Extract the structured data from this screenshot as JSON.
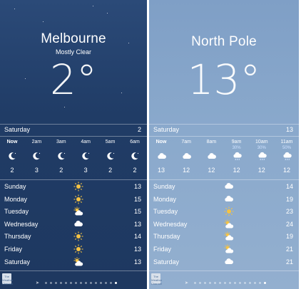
{
  "left": {
    "city": "Melbourne",
    "condition": "Mostly Clear",
    "temperature": "2°",
    "today": {
      "day": "Saturday",
      "value": "2"
    },
    "hours": [
      {
        "label": "Now",
        "icon": "moon-icon",
        "temp": "2"
      },
      {
        "label": "2am",
        "icon": "moon-icon",
        "temp": "3"
      },
      {
        "label": "3am",
        "icon": "moon-icon",
        "temp": "2"
      },
      {
        "label": "4am",
        "icon": "moon-icon",
        "temp": "3"
      },
      {
        "label": "5am",
        "icon": "moon-icon",
        "temp": "2"
      },
      {
        "label": "6am",
        "icon": "moon-icon",
        "temp": "2"
      }
    ],
    "days": [
      {
        "day": "Sunday",
        "icon": "sun-icon",
        "temp": "13"
      },
      {
        "day": "Monday",
        "icon": "sun-icon",
        "temp": "15"
      },
      {
        "day": "Tuesday",
        "icon": "partly-cloudy-icon",
        "temp": "15"
      },
      {
        "day": "Wednesday",
        "icon": "cloud-icon",
        "temp": "13"
      },
      {
        "day": "Thursday",
        "icon": "sun-icon",
        "temp": "14"
      },
      {
        "day": "Friday",
        "icon": "sun-icon",
        "temp": "13"
      },
      {
        "day": "Saturday",
        "icon": "partly-cloudy-icon",
        "temp": "13"
      }
    ]
  },
  "right": {
    "city": "North Pole",
    "temperature": "13°",
    "today": {
      "day": "Saturday",
      "value": "13"
    },
    "hours": [
      {
        "label": "Now",
        "icon": "cloud-icon",
        "temp": "13",
        "pct": ""
      },
      {
        "label": "7am",
        "icon": "cloud-icon",
        "temp": "12",
        "pct": ""
      },
      {
        "label": "8am",
        "icon": "cloud-icon",
        "temp": "12",
        "pct": ""
      },
      {
        "label": "9am",
        "icon": "rain-cloud-icon",
        "temp": "12",
        "pct": "30%"
      },
      {
        "label": "10am",
        "icon": "rain-cloud-icon",
        "temp": "12",
        "pct": "30%"
      },
      {
        "label": "11am",
        "icon": "rain-cloud-icon",
        "temp": "12",
        "pct": "50%"
      }
    ],
    "days": [
      {
        "day": "Sunday",
        "icon": "cloud-icon",
        "temp": "14"
      },
      {
        "day": "Monday",
        "icon": "cloud-icon",
        "temp": "19"
      },
      {
        "day": "Tuesday",
        "icon": "sun-icon",
        "temp": "23"
      },
      {
        "day": "Wednesday",
        "icon": "partly-cloudy-icon",
        "temp": "24"
      },
      {
        "day": "Thursday",
        "icon": "partly-cloudy-icon",
        "temp": "19"
      },
      {
        "day": "Friday",
        "icon": "partly-cloudy-icon",
        "temp": "21"
      },
      {
        "day": "Saturday",
        "icon": "cloud-icon",
        "temp": "21"
      }
    ]
  },
  "logo_text": "The Weather Channel",
  "colors": {
    "sun": "#f6c343",
    "left_bg": "#233f69",
    "right_bg": "#8aa9cc",
    "pct": "#cfe3ff"
  }
}
